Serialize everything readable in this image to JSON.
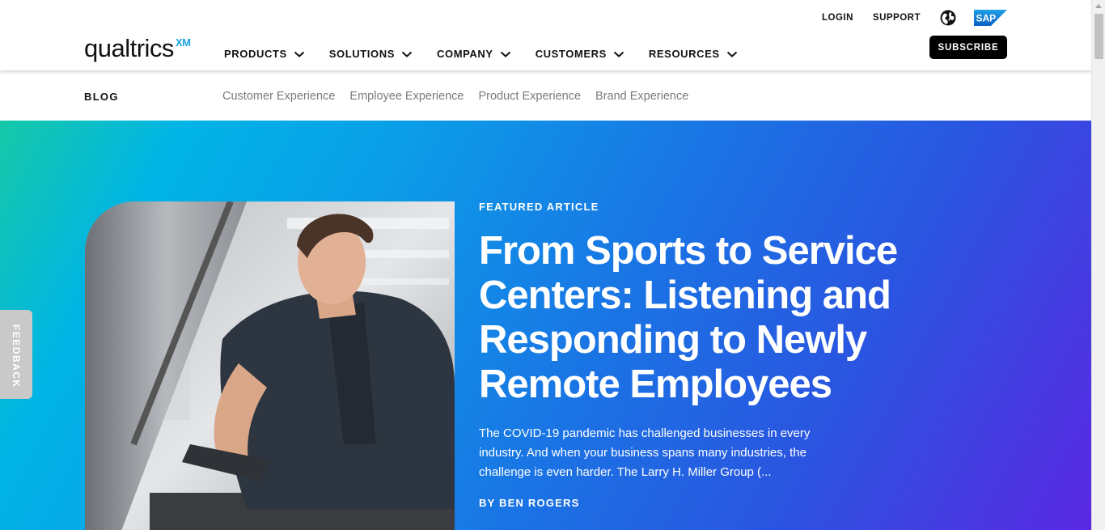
{
  "header": {
    "logo_text": "qualtrics",
    "logo_mark": "XM",
    "utility": {
      "login": "LOGIN",
      "support": "SUPPORT"
    },
    "globe_icon": "globe-icon",
    "sap_logo": "SAP",
    "nav": [
      {
        "label": "PRODUCTS"
      },
      {
        "label": "SOLUTIONS"
      },
      {
        "label": "COMPANY"
      },
      {
        "label": "CUSTOMERS"
      },
      {
        "label": "RESOURCES"
      }
    ],
    "subscribe_label": "SUBSCRIBE"
  },
  "blog_nav": {
    "label": "BLOG",
    "categories": [
      {
        "label": "Customer Experience"
      },
      {
        "label": "Employee Experience"
      },
      {
        "label": "Product Experience"
      },
      {
        "label": "Brand Experience"
      }
    ]
  },
  "hero": {
    "eyebrow": "FEATURED ARTICLE",
    "title": "From Sports to Service Centers: Listening and Responding to Newly Remote Employees",
    "excerpt": "The COVID-19 pandemic has challenged businesses in every industry. And when your business spans many industries, the challenge is even harder. The Larry H. Miller Group (...",
    "byline": "BY BEN ROGERS",
    "image": "mechanic-working-under-car-hood"
  },
  "feedback_label": "FEEDBACK",
  "colors": {
    "accent_blue": "#1aa2e0",
    "hero_gradient_start": "#16c9a8",
    "hero_gradient_end": "#5a28e2",
    "button_black": "#000000"
  }
}
